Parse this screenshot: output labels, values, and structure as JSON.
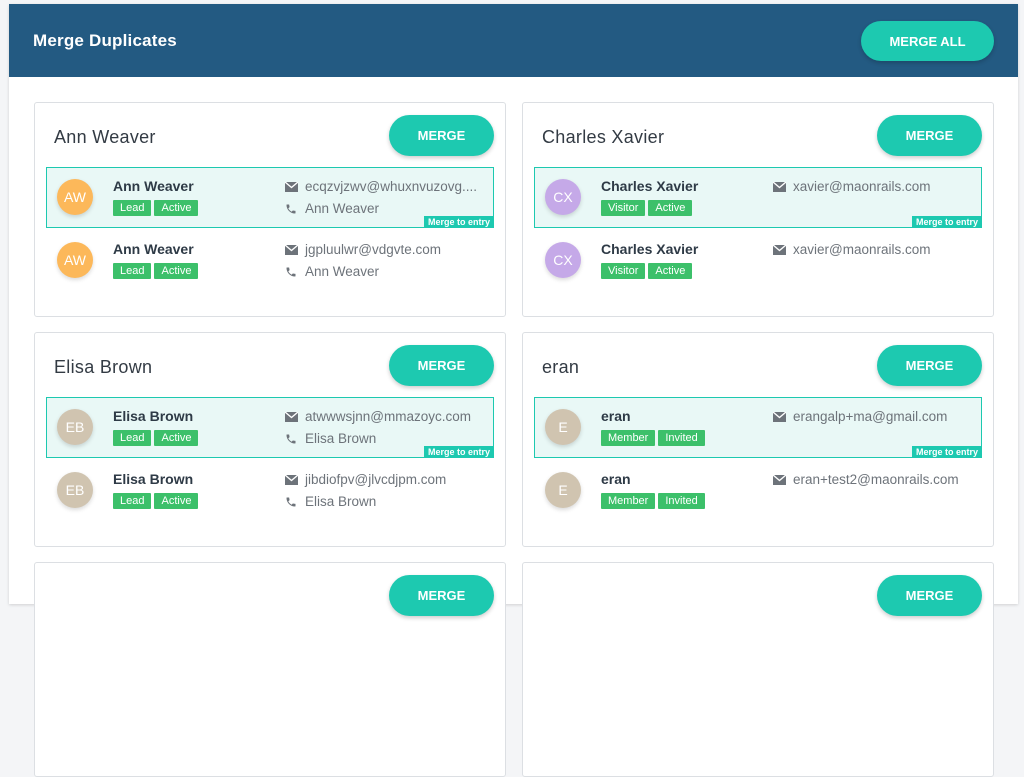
{
  "header": {
    "title": "Merge Duplicates",
    "merge_all_label": "MERGE ALL"
  },
  "colors": {
    "header_bg": "#235a82",
    "accent": "#1dc9b0",
    "badge": "#3cc06a"
  },
  "icons": {
    "email": "envelope-icon",
    "phone": "phone-icon"
  },
  "merge_label": "MERGE",
  "merge_to_entry_label": "Merge to entry",
  "cards": [
    {
      "title": "Ann Weaver",
      "entries": [
        {
          "initials": "AW",
          "avatar_color": "#fcb85a",
          "name": "Ann Weaver",
          "badges": [
            "Lead",
            "Active"
          ],
          "email": "ecqzvjzwv@whuxnvuzovg....",
          "phone": "Ann Weaver",
          "selected": true
        },
        {
          "initials": "AW",
          "avatar_color": "#fcb85a",
          "name": "Ann Weaver",
          "badges": [
            "Lead",
            "Active"
          ],
          "email": "jgpluulwr@vdgvte.com",
          "phone": "Ann Weaver",
          "selected": false
        }
      ]
    },
    {
      "title": "Charles Xavier",
      "entries": [
        {
          "initials": "CX",
          "avatar_color": "#c5a9e8",
          "name": "Charles Xavier",
          "badges": [
            "Visitor",
            "Active"
          ],
          "email": "xavier@maonrails.com",
          "phone": "",
          "selected": true
        },
        {
          "initials": "CX",
          "avatar_color": "#c5a9e8",
          "name": "Charles Xavier",
          "badges": [
            "Visitor",
            "Active"
          ],
          "email": "xavier@maonrails.com",
          "phone": "",
          "selected": false
        }
      ]
    },
    {
      "title": "Elisa Brown",
      "entries": [
        {
          "initials": "EB",
          "avatar_color": "#d0c4b0",
          "name": "Elisa Brown",
          "badges": [
            "Lead",
            "Active"
          ],
          "email": "atwwwsjnn@mmazoyc.com",
          "phone": "Elisa Brown",
          "selected": true
        },
        {
          "initials": "EB",
          "avatar_color": "#d0c4b0",
          "name": "Elisa Brown",
          "badges": [
            "Lead",
            "Active"
          ],
          "email": "jibdiofpv@jlvcdjpm.com",
          "phone": "Elisa Brown",
          "selected": false
        }
      ]
    },
    {
      "title": "eran",
      "entries": [
        {
          "initials": "E",
          "avatar_color": "#d0c4b0",
          "name": "eran",
          "badges": [
            "Member",
            "Invited"
          ],
          "email": "erangalp+ma@gmail.com",
          "phone": "",
          "selected": true
        },
        {
          "initials": "E",
          "avatar_color": "#d0c4b0",
          "name": "eran",
          "badges": [
            "Member",
            "Invited"
          ],
          "email": "eran+test2@maonrails.com",
          "phone": "",
          "selected": false
        }
      ]
    }
  ]
}
